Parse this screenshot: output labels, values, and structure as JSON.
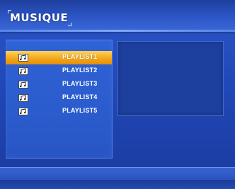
{
  "header": {
    "title": "MUSIQUE"
  },
  "playlists": {
    "items": [
      {
        "label": "PLAYLIST1",
        "selected": true,
        "icon": "music-folder-icon"
      },
      {
        "label": "PLAYLIST2",
        "selected": false,
        "icon": "music-folder-icon"
      },
      {
        "label": "PLAYLIST3",
        "selected": false,
        "icon": "music-folder-icon"
      },
      {
        "label": "PLAYLIST4",
        "selected": false,
        "icon": "music-folder-icon"
      },
      {
        "label": "PLAYLIST5",
        "selected": false,
        "icon": "music-folder-icon"
      }
    ]
  },
  "colors": {
    "background": "#2148b8",
    "selection": "#f3a81c",
    "preview_panel": "#1d3f9d"
  }
}
